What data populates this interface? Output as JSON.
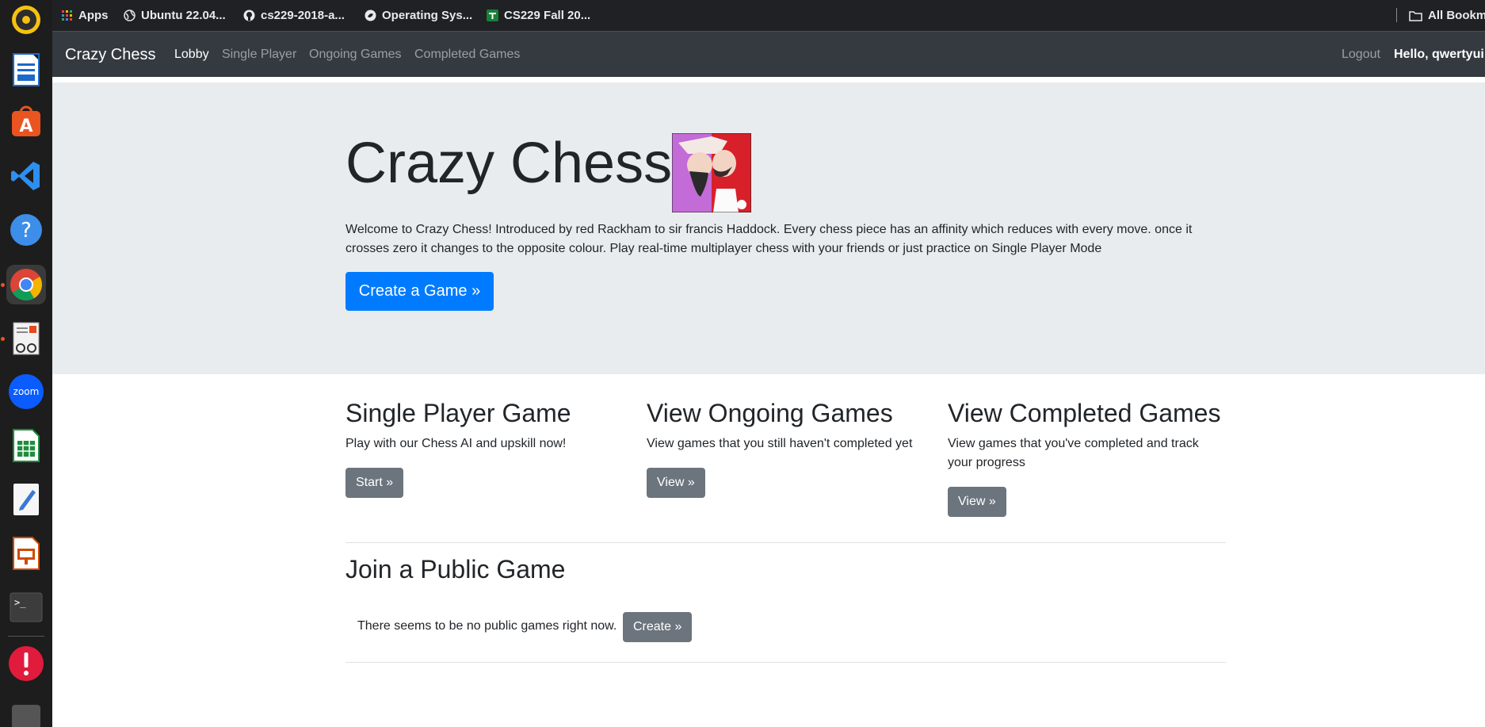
{
  "bookmarks": {
    "apps": "Apps",
    "items": [
      "Ubuntu 22.04...",
      "cs229-2018-a...",
      "Operating Sys...",
      "CS229 Fall 20..."
    ],
    "all_bookmarks": "All Bookm"
  },
  "nav": {
    "brand": "Crazy Chess",
    "links": [
      "Lobby",
      "Single Player",
      "Ongoing Games",
      "Completed Games"
    ],
    "logout": "Logout",
    "hello": "Hello, qwertyui"
  },
  "hero": {
    "title": "Crazy Chess",
    "text": "Welcome to Crazy Chess! Introduced by red Rackham to sir francis Haddock. Every chess piece has an affinity which reduces with every move. once it crosses zero it changes to the opposite colour. Play real-time multiplayer chess with your friends or just practice on Single Player Mode",
    "button": "Create a Game »"
  },
  "columns": [
    {
      "title": "Single Player Game",
      "text": "Play with our Chess AI and upskill now!",
      "button": "Start »"
    },
    {
      "title": "View Ongoing Games",
      "text": "View games that you still haven't completed yet",
      "button": "View »"
    },
    {
      "title": "View Completed Games",
      "text": "View games that you've completed and track your progress",
      "button": "View »"
    }
  ],
  "public": {
    "title": "Join a Public Game",
    "empty_text": "There seems to be no public games right now.",
    "button": "Create »"
  },
  "colors": {
    "primary": "#007bff",
    "secondary": "#6c757d",
    "navbar": "#343a40",
    "jumbotron": "#e9ecef"
  }
}
